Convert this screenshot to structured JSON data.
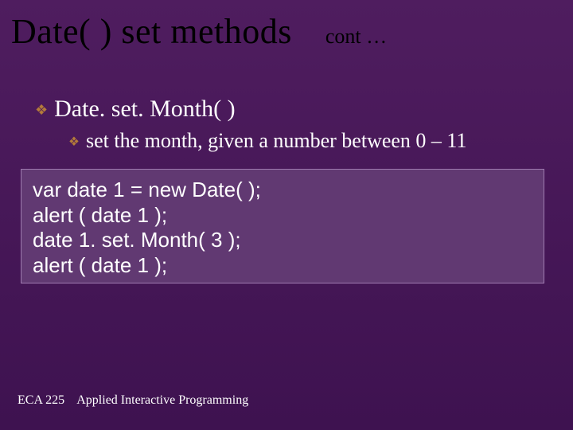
{
  "header": {
    "title": "Date( ) set methods",
    "cont": "cont …"
  },
  "bullet1": {
    "text": "Date. set. Month(  )"
  },
  "bullet2": {
    "text": "set the month, given a number between 0 – 11"
  },
  "code": {
    "line1": "var date 1 = new Date( );",
    "line2": "alert ( date 1 );",
    "line3": "date 1. set. Month( 3 );",
    "line4": "alert ( date 1 );"
  },
  "footer": {
    "course": "ECA 225",
    "title": "Applied Interactive Programming"
  }
}
